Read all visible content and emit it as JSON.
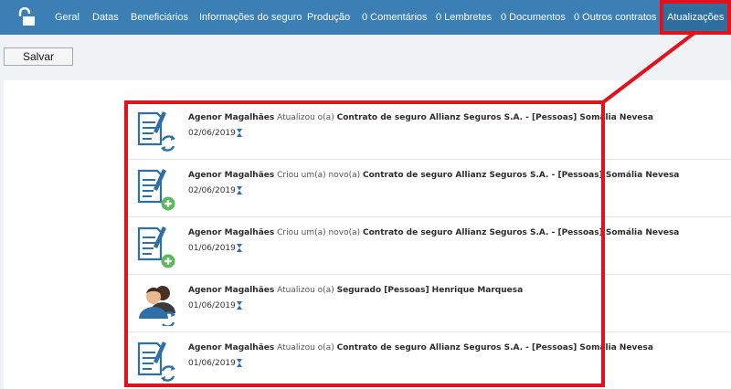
{
  "nav": {
    "items": [
      {
        "label": "Geral"
      },
      {
        "label": "Datas"
      },
      {
        "label": "Beneficiários"
      },
      {
        "label": "Informações do seguro"
      },
      {
        "label": "Produção"
      },
      {
        "label": "0 Comentários"
      },
      {
        "label": "0 Lembretes"
      },
      {
        "label": "0 Documentos"
      },
      {
        "label": "0 Outros contratos"
      },
      {
        "label": "Atualizações"
      }
    ],
    "active": "Atualizações"
  },
  "toolbar": {
    "save_label": "Salvar"
  },
  "feed": {
    "items": [
      {
        "icon": "document-update-icon",
        "user": "Agenor Magalhães",
        "action": "Atualizou o(a)",
        "target": "Contrato de seguro Allianz Seguros S.A. - [Pessoas] Somália Nevesa",
        "date": "02/06/2019"
      },
      {
        "icon": "document-add-icon",
        "user": "Agenor Magalhães",
        "action": "Criou um(a) novo(a)",
        "target": "Contrato de seguro Allianz Seguros S.A. - [Pessoas] Somália Nevesa",
        "date": "02/06/2019"
      },
      {
        "icon": "document-add-icon",
        "user": "Agenor Magalhães",
        "action": "Criou um(a) novo(a)",
        "target": "Contrato de seguro Allianz Seguros S.A. - [Pessoas] Somália Nevesa",
        "date": "01/06/2019"
      },
      {
        "icon": "people-update-icon",
        "user": "Agenor Magalhães",
        "action": "Atualizou o(a)",
        "target": "Segurado [Pessoas] Henrique Marquesa",
        "date": "01/06/2019"
      },
      {
        "icon": "document-update-icon",
        "user": "Agenor Magalhães",
        "action": "Atualizou o(a)",
        "target": "Contrato de seguro Allianz Seguros S.A. - [Pessoas] Somália Nevesa",
        "date": "01/06/2019"
      }
    ]
  },
  "colors": {
    "navbar": "#3b7fb4",
    "highlight": "#e0121e",
    "icon_blue": "#2e6fa7",
    "icon_green": "#5cb85c"
  }
}
